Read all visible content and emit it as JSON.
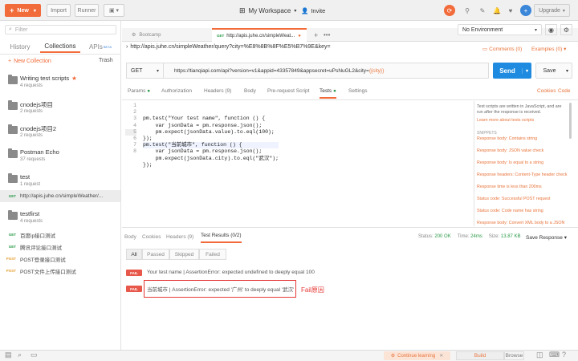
{
  "colors": {
    "accent": "#f26b3a",
    "send": "#1e8be0",
    "fail": "#e8584a",
    "pass": "#2a9a47"
  },
  "topbar": {
    "new": "New",
    "import": "Import",
    "runner": "Runner",
    "workspace": "My Workspace",
    "invite": "Invite",
    "upgrade": "Upgrade"
  },
  "sidebar": {
    "filter_placeholder": "Filter",
    "tabs": {
      "history": "History",
      "collections": "Collections",
      "apis": "APIs",
      "beta": "BETA"
    },
    "new_collection": "New Collection",
    "trash": "Trash",
    "collections": [
      {
        "name": "Writing test scripts",
        "sub": "4 requests"
      },
      {
        "name": "cnodejs项目",
        "sub": "2 requests"
      },
      {
        "name": "cnodejs项目2",
        "sub": "2 requests"
      },
      {
        "name": "Postman Echo",
        "sub": "37 requests"
      },
      {
        "name": "test",
        "sub": "1 request"
      },
      {
        "name": "testfirst",
        "sub": "4 requests"
      }
    ],
    "test_request": {
      "method": "GET",
      "name": "http://apis.juhe.cn/simpleWeather/..."
    },
    "testfirst_requests": [
      {
        "method": "GET",
        "name": "百度ip接口测试"
      },
      {
        "method": "GET",
        "name": "腾讯评论接口测试"
      },
      {
        "method": "POST",
        "name": "POST登录接口测试"
      },
      {
        "method": "POST",
        "name": "POST文件上传接口测试"
      }
    ]
  },
  "tabs": [
    {
      "label": "Bootcamp"
    },
    {
      "method": "GET",
      "label": "http://apis.juhe.cn/simpleWeat..."
    }
  ],
  "environment": "No Environment",
  "request": {
    "title": "http://apis.juhe.cn/simpleWeather/query?city=%E8%8B%8F%E5%B7%9E&key=",
    "comments": "Comments (0)",
    "examples": "Examples (0)",
    "method": "GET",
    "url": "https://tianqiapi.com/api?version=v1&appid=43357849&appsecret=uPsNuGL2&city=",
    "url_var": "{{city}}",
    "send": "Send",
    "save": "Save",
    "subtabs": [
      "Params",
      "Authorization",
      "Headers (9)",
      "Body",
      "Pre-request Script",
      "Tests",
      "Settings"
    ],
    "cookies": "Cookies",
    "code": "Code"
  },
  "editor": {
    "lines": [
      "pm.test(\"Your test name\", function () {",
      "    var jsonData = pm.response.json();",
      "    pm.expect(jsonData.value).to.eql(100);",
      "});",
      "pm.test(\"当前城市\", function () {",
      "    var jsonData = pm.response.json();",
      "    pm.expect(jsonData.city).to.eql(\"武汉\");",
      "});"
    ],
    "numbers": [
      "1",
      "2",
      "3",
      "4",
      "5",
      "6",
      "7",
      "8"
    ]
  },
  "snippets": {
    "intro": "Test scripts are written in JavaScript, and are run after the response is received.",
    "learn": "Learn more about tests scripts",
    "heading": "SNIPPETS",
    "items": [
      "Response body: Contains string",
      "Response body: JSON value check",
      "Response body: Is equal to a string",
      "Response headers: Content-Type header check",
      "Response time is less than 200ms",
      "Status code: Successful POST request",
      "Status code: Code name has string",
      "Response body: Convert XML body to a JSON"
    ]
  },
  "response": {
    "tabs": [
      "Body",
      "Cookies",
      "Headers (9)",
      "Test Results (0/2)"
    ],
    "status_label": "Status:",
    "status": "200 OK",
    "time_label": "Time:",
    "time": "24ms",
    "size_label": "Size:",
    "size": "13.87 KB",
    "save": "Save Response",
    "filters": [
      "All",
      "Passed",
      "Skipped",
      "Failed"
    ],
    "results": [
      {
        "badge": "FAIL",
        "text": "Your test name | AssertionError: expected undefined to deeply equal 100"
      },
      {
        "badge": "FAIL",
        "text": "当前城市 | AssertionError: expected '广州' to deeply equal '武汉'"
      }
    ],
    "annotation": "Fail原因"
  },
  "statusbar": {
    "learning": "Continue learning",
    "build": "Build",
    "browse": "Browse"
  }
}
